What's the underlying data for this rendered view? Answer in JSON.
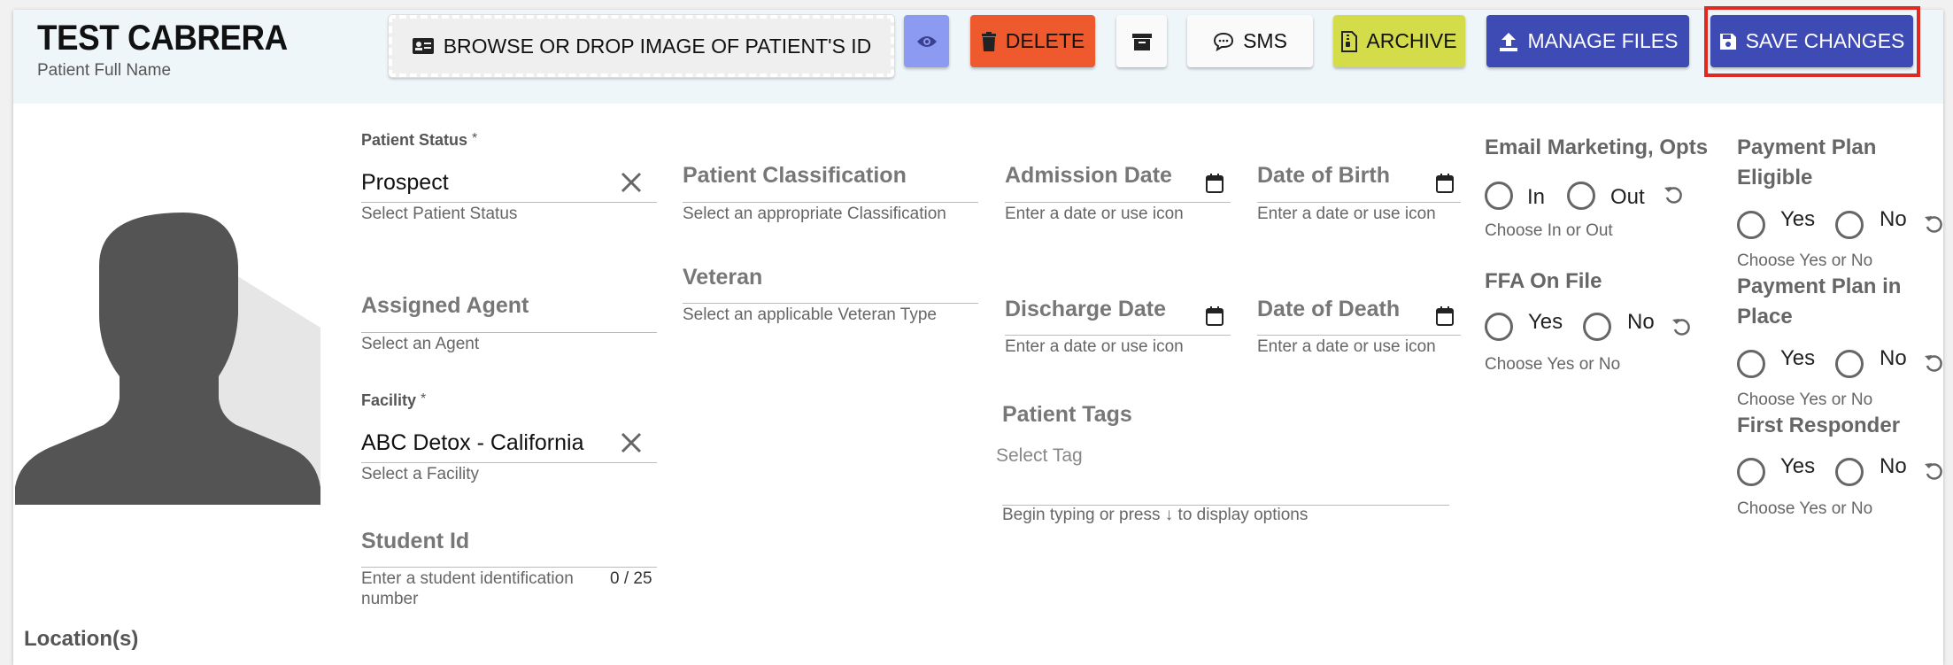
{
  "header": {
    "title": "TEST CABRERA",
    "subtitle": "Patient Full Name"
  },
  "toolbar": {
    "browse_label": "BROWSE OR DROP IMAGE OF PATIENT'S ID",
    "delete_label": "DELETE",
    "sms_label": "SMS",
    "archive_label": "ARCHIVE",
    "manage_files_label": "MANAGE FILES",
    "save_label": "SAVE CHANGES"
  },
  "icons": {
    "browse": "id-card-icon",
    "eye": "eye-icon",
    "delete": "trash-icon",
    "box": "archive-box-icon",
    "sms": "chat-bubble-icon",
    "archive": "file-archive-icon",
    "manage": "upload-icon",
    "save": "floppy-disk-icon"
  },
  "colors": {
    "header_bg": "#eef6fa",
    "eye_btn": "#8c9af1",
    "delete_btn": "#ee5a2d",
    "archive_btn": "#d4dc4a",
    "primary_btn": "#3f4bb5",
    "highlight_border": "#e02a1f"
  },
  "fields": {
    "patient_status": {
      "label": "Patient Status",
      "required_mark": "*",
      "value": "Prospect",
      "hint": "Select Patient Status"
    },
    "assigned_agent": {
      "label": "Assigned Agent",
      "hint": "Select an Agent"
    },
    "facility": {
      "label": "Facility",
      "required_mark": "*",
      "value": "ABC Detox - California",
      "hint": "Select a Facility"
    },
    "student_id": {
      "label": "Student Id",
      "hint_line1": "Enter a student identification",
      "hint_line2": "number",
      "counter": "0 / 25"
    },
    "patient_classification": {
      "label": "Patient Classification",
      "hint": "Select an appropriate Classification"
    },
    "veteran": {
      "label": "Veteran",
      "hint": "Select an applicable Veteran Type"
    },
    "admission_date": {
      "label": "Admission Date",
      "hint": "Enter a date or use icon"
    },
    "discharge_date": {
      "label": "Discharge Date",
      "hint": "Enter a date or use icon"
    },
    "date_of_birth": {
      "label": "Date of Birth",
      "hint": "Enter a date or use icon"
    },
    "date_of_death": {
      "label": "Date of Death",
      "hint": "Enter a date or use icon"
    },
    "patient_tags": {
      "label": "Patient Tags",
      "placeholder": "Select Tag",
      "hint": "Begin typing or press ↓ to display options"
    }
  },
  "radio_groups": {
    "email_marketing": {
      "title": "Email Marketing, Opts",
      "opt1": "In",
      "opt2": "Out",
      "hint": "Choose In or Out"
    },
    "ffa_on_file": {
      "title": "FFA On File",
      "opt1": "Yes",
      "opt2": "No",
      "hint": "Choose Yes or No"
    },
    "payment_plan_eligible": {
      "title_line1": "Payment Plan",
      "title_line2": "Eligible",
      "opt1": "Yes",
      "opt2": "No",
      "hint": "Choose Yes or No"
    },
    "payment_plan_in_place": {
      "title_line1": "Payment Plan in",
      "title_line2": "Place",
      "opt1": "Yes",
      "opt2": "No",
      "hint": "Choose Yes or No"
    },
    "first_responder": {
      "title": "First Responder",
      "opt1": "Yes",
      "opt2": "No",
      "hint": "Choose Yes or No"
    }
  },
  "location_label": "Location(s)"
}
